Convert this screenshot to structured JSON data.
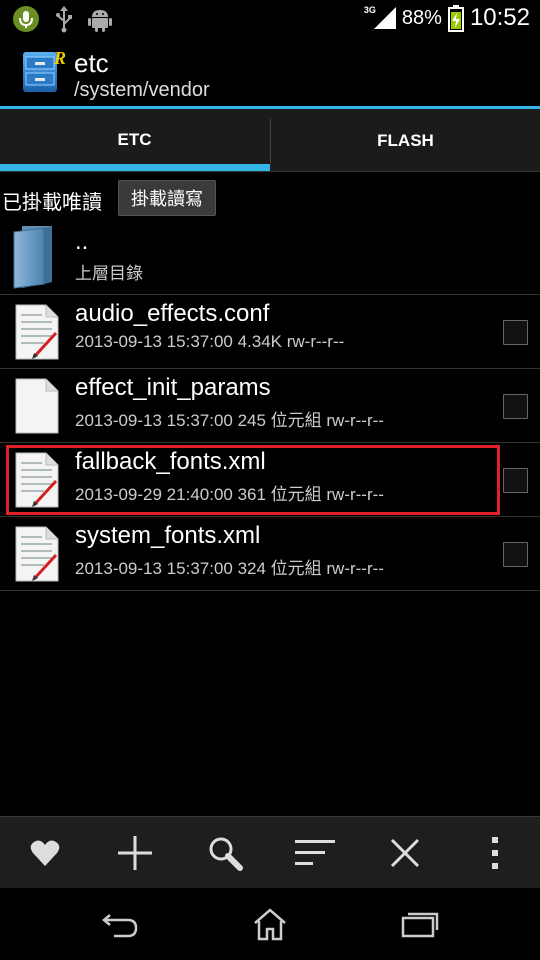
{
  "status_bar": {
    "icons": [
      "mic-icon",
      "usb-icon",
      "android-icon"
    ],
    "network": "3G",
    "battery": "88%",
    "time": "10:52"
  },
  "action_bar": {
    "title": "etc",
    "subtitle": "/system/vendor",
    "accent": "#33b5e5"
  },
  "tabs": [
    {
      "label": "ETC",
      "selected": true
    },
    {
      "label": "FLASH",
      "selected": false
    }
  ],
  "mount": {
    "status": "已掛載唯讀",
    "button": "掛載讀寫"
  },
  "files": {
    "parent": {
      "name": "..",
      "meta": "上層目錄"
    },
    "items": [
      {
        "name": "audio_effects.conf",
        "meta": "2013-09-13 15:37:00  4.34K  rw-r--r--",
        "icon": "text-file-icon"
      },
      {
        "name": "effect_init_params",
        "meta": "2013-09-13 15:37:00  245 位元組  rw-r--r--",
        "icon": "blank-file-icon"
      },
      {
        "name": "fallback_fonts.xml",
        "meta": "2013-09-29 21:40:00  361 位元組  rw-r--r--",
        "icon": "text-file-icon"
      },
      {
        "name": "system_fonts.xml",
        "meta": "2013-09-13 15:37:00  324 位元組  rw-r--r--",
        "icon": "text-file-icon"
      }
    ]
  },
  "toolbar": [
    "heart-icon",
    "plus-icon",
    "search-icon",
    "sort-icon",
    "close-icon",
    "overflow-menu-icon"
  ],
  "navigation": [
    "back-icon",
    "home-icon",
    "recent-apps-icon"
  ]
}
